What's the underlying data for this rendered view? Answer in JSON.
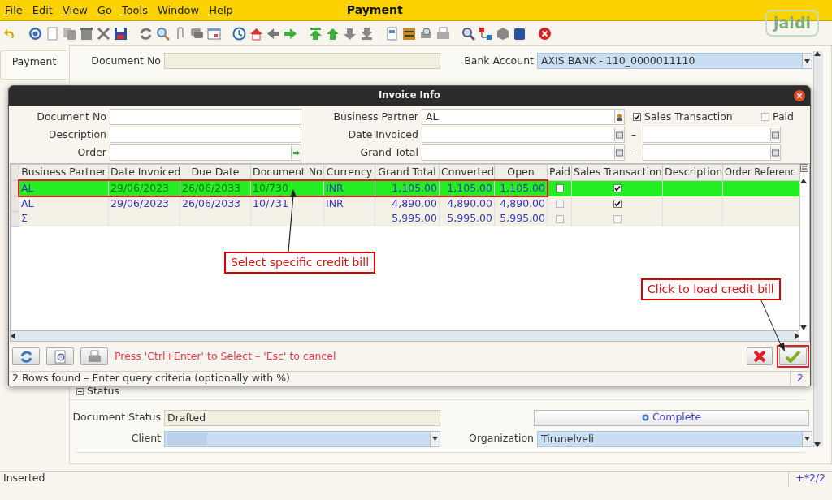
{
  "window": {
    "title": "Payment",
    "logo": "jaldi"
  },
  "menu": [
    {
      "label": "File",
      "mnemonic": true
    },
    {
      "label": "Edit",
      "mnemonic": true
    },
    {
      "label": "View",
      "mnemonic": true
    },
    {
      "label": "Go",
      "mnemonic": true
    },
    {
      "label": "Tools",
      "mnemonic": true
    },
    {
      "label": "Window",
      "mnemonic": false
    },
    {
      "label": "Help",
      "mnemonic": true
    }
  ],
  "tabs": [
    {
      "label": "Payment",
      "selected": true
    }
  ],
  "form": {
    "document_no": {
      "label": "Document No"
    },
    "bank_account": {
      "label": "Bank Account",
      "value": "AXIS BANK - 110_0000011110"
    },
    "status_section": {
      "label": "Status",
      "expanded": true
    },
    "document_status": {
      "label": "Document Status",
      "value": "Drafted"
    },
    "complete_button": "Complete",
    "client": {
      "label": "Client"
    },
    "organization": {
      "label": "Organization",
      "value": "Tirunelveli"
    }
  },
  "dialog": {
    "title": "Invoice Info",
    "filter_rows": [
      [
        {
          "kind": "text",
          "label": "Document No"
        },
        {
          "kind": "lookup",
          "label": "Business Partner",
          "value": "AL"
        },
        {
          "kind": "check",
          "label": "Sales Transaction",
          "checked": true
        },
        {
          "kind": "check",
          "label": "Paid",
          "checked": false
        }
      ],
      [
        {
          "kind": "text",
          "label": "Description"
        },
        {
          "kind": "range",
          "label": "Date Invoiced",
          "separator": "–"
        }
      ],
      [
        {
          "kind": "lookup",
          "label": "Order"
        },
        {
          "kind": "range",
          "label": "Grand Total",
          "separator": "–"
        }
      ]
    ],
    "table": {
      "columns": [
        "Business Partner",
        "Date Invoiced",
        "Due Date",
        "Document No",
        "Currency",
        "Grand Total",
        "Converted",
        "Open",
        "Paid",
        "Sales Transaction",
        "Description",
        "Order Referenc"
      ],
      "rows": [
        {
          "kind": "item",
          "selected": true,
          "cells": [
            "AL",
            "29/06/2023",
            "26/06/2033",
            "10/730",
            "INR",
            "1,105.00",
            "1,105.00",
            "1,105.00"
          ],
          "paid": false,
          "sales_transaction": true
        },
        {
          "kind": "item",
          "selected": false,
          "cells": [
            "AL",
            "29/06/2023",
            "26/06/2033",
            "10/731",
            "INR",
            "4,890.00",
            "4,890.00",
            "4,890.00"
          ],
          "paid": false,
          "sales_transaction": true
        },
        {
          "kind": "total",
          "selected": false,
          "cells": [
            "Σ",
            "",
            "",
            "",
            "",
            "5,995.00",
            "5,995.00",
            "5,995.00"
          ]
        }
      ]
    },
    "hint": "Press 'Ctrl+Enter' to Select – 'Esc' to cancel",
    "status": "2 Rows found – Enter query criteria (optionally with %)",
    "count": "2"
  },
  "annotations": [
    {
      "text": "Select specific credit bill"
    },
    {
      "text": "Click to load credit bill"
    }
  ],
  "status_bar": {
    "message": "Inserted",
    "position": "+*2/2"
  }
}
